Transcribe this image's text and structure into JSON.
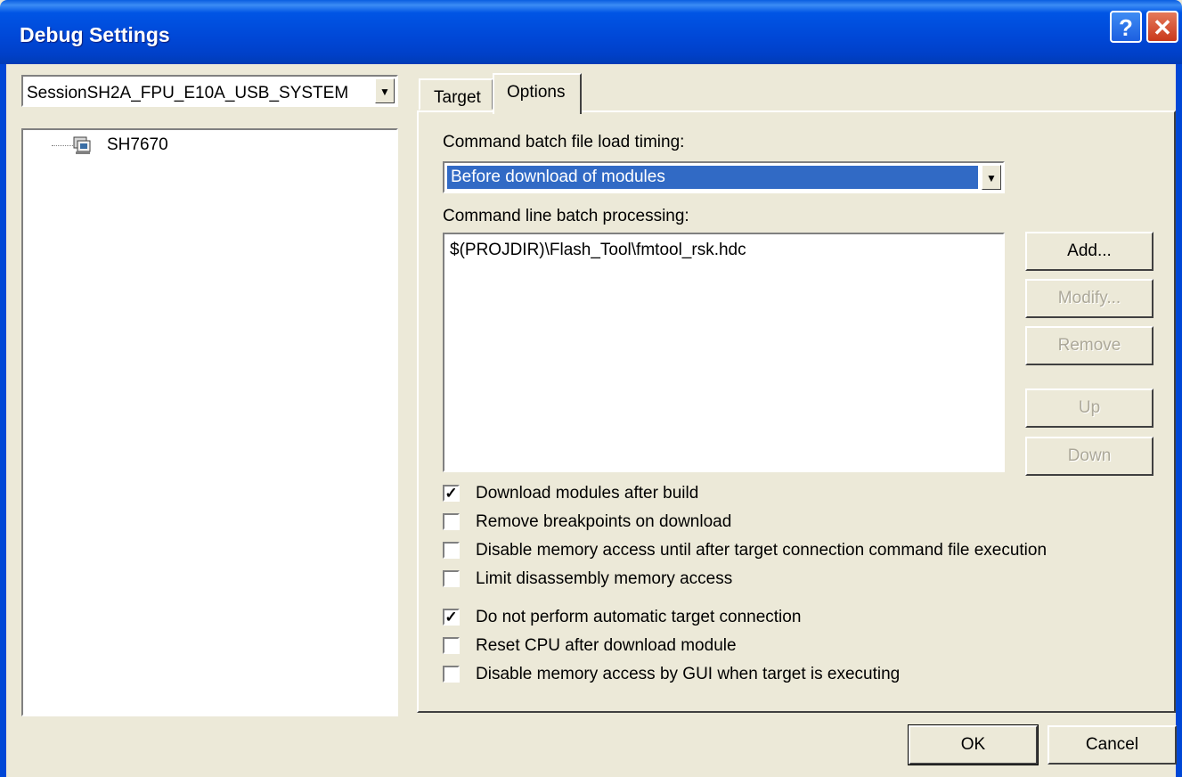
{
  "window": {
    "title": "Debug Settings",
    "help_label": "?",
    "close_label": "✕"
  },
  "session": {
    "selected": "SessionSH2A_FPU_E10A_USB_SYSTEM"
  },
  "tree": {
    "items": [
      {
        "label": "SH7670",
        "icon": "device-icon"
      }
    ]
  },
  "tabs": [
    {
      "label": "Target",
      "active": false
    },
    {
      "label": "Options",
      "active": true
    }
  ],
  "options": {
    "timing_label": "Command batch file load timing:",
    "timing_value": "Before download of modules",
    "batch_label": "Command line batch processing:",
    "batch_items": [
      "$(PROJDIR)\\Flash_Tool\\fmtool_rsk.hdc"
    ],
    "buttons": {
      "add": "Add...",
      "modify": "Modify...",
      "remove": "Remove",
      "up": "Up",
      "down": "Down"
    },
    "checks": [
      {
        "label": "Download modules after build",
        "checked": true
      },
      {
        "label": "Remove breakpoints on download",
        "checked": false
      },
      {
        "label": "Disable memory access until after target connection command file execution",
        "checked": false
      },
      {
        "label": "Limit disassembly memory access",
        "checked": false
      },
      {
        "label": "Do not perform automatic target connection",
        "checked": true
      },
      {
        "label": "Reset CPU after download module",
        "checked": false
      },
      {
        "label": "Disable memory access by GUI when target is executing",
        "checked": false
      }
    ]
  },
  "footer": {
    "ok": "OK",
    "cancel": "Cancel"
  },
  "colors": {
    "titlebar": "#0047d6",
    "selection": "#316ac5",
    "face": "#ece9d8"
  }
}
